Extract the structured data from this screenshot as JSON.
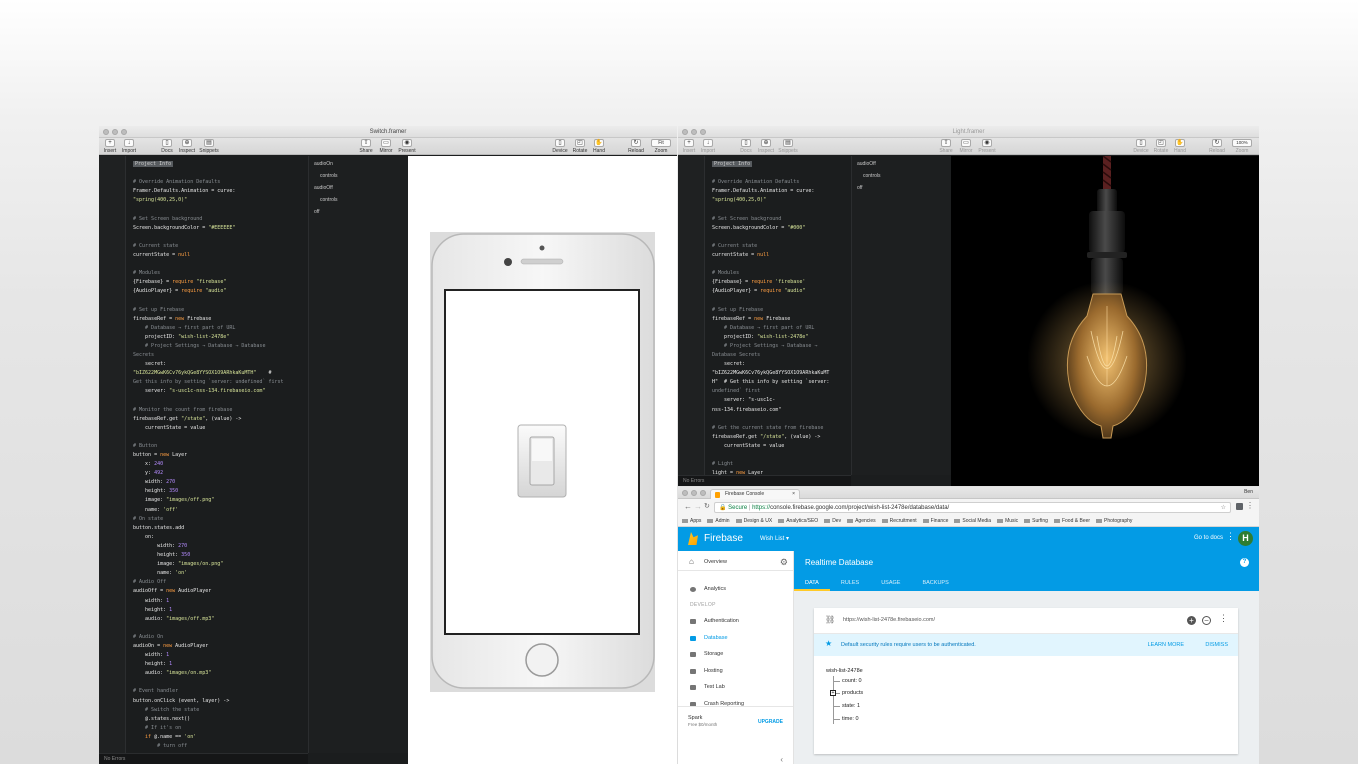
{
  "left_window": {
    "title": "Switch.framer",
    "toolbar": {
      "left": [
        "Insert",
        "Import",
        "Docs",
        "Inspect",
        "Snippets"
      ],
      "center": [
        "Share",
        "Mirror",
        "Present"
      ],
      "right": [
        "Device",
        "Rotate",
        "Hand",
        "Reload",
        "Zoom"
      ],
      "zoom_value": "Fit"
    },
    "code_lines": [
      {
        "t": "Project Info",
        "c": "hl"
      },
      {
        "t": "",
        "c": ""
      },
      {
        "t": "# Override Animation Defaults",
        "c": "cmt"
      },
      {
        "t": "Framer.Defaults.Animation = curve:",
        "c": ""
      },
      {
        "t": "\"spring(400,25,0)\"",
        "c": ""
      },
      {
        "t": "",
        "c": ""
      },
      {
        "t": "# Set Screen background",
        "c": "cmt"
      },
      {
        "t": "Screen.backgroundColor = \"#EEEEEE\"",
        "c": ""
      },
      {
        "t": "",
        "c": ""
      },
      {
        "t": "# Current state",
        "c": "cmt"
      },
      {
        "t": "currentState = null",
        "c": ""
      },
      {
        "t": "",
        "c": ""
      },
      {
        "t": "# Modules",
        "c": "cmt"
      },
      {
        "t": "{Firebase} = require \"firebase\"",
        "c": ""
      },
      {
        "t": "{AudioPlayer} = require \"audio\"",
        "c": ""
      },
      {
        "t": "",
        "c": ""
      },
      {
        "t": "# Set up Firebase",
        "c": "cmt"
      },
      {
        "t": "firebaseRef = new Firebase",
        "c": ""
      },
      {
        "t": "    # Database → first part of URL",
        "c": "cmt"
      },
      {
        "t": "    projectID: \"wish-list-2478e\"",
        "c": ""
      },
      {
        "t": "    # Project Settings → Database → Database",
        "c": "cmt"
      },
      {
        "t": "Secrets",
        "c": "cmt"
      },
      {
        "t": "    secret:",
        "c": ""
      },
      {
        "t": "\"bIZ622MGwK6Cv76ykQGe8YYSOX1O9ARhkaKuMTH\"    #",
        "c": ""
      },
      {
        "t": "Get this info by setting `server: undefined` first",
        "c": "cmt"
      },
      {
        "t": "    server: \"s-usc1c-nss-134.firebaseio.com\"",
        "c": ""
      },
      {
        "t": "",
        "c": ""
      },
      {
        "t": "# Monitor the count from firebase",
        "c": "cmt"
      },
      {
        "t": "firebaseRef.get \"/state\", (value) ->",
        "c": ""
      },
      {
        "t": "    currentState = value",
        "c": ""
      },
      {
        "t": "",
        "c": ""
      },
      {
        "t": "# Button",
        "c": "cmt"
      },
      {
        "t": "button = new Layer",
        "c": ""
      },
      {
        "t": "    x: 240",
        "c": ""
      },
      {
        "t": "    y: 492",
        "c": ""
      },
      {
        "t": "    width: 270",
        "c": ""
      },
      {
        "t": "    height: 350",
        "c": ""
      },
      {
        "t": "    image: \"images/off.png\"",
        "c": ""
      },
      {
        "t": "    name: 'off'",
        "c": ""
      },
      {
        "t": "# On state",
        "c": "cmt"
      },
      {
        "t": "button.states.add",
        "c": ""
      },
      {
        "t": "    on:",
        "c": ""
      },
      {
        "t": "        width: 270",
        "c": ""
      },
      {
        "t": "        height: 350",
        "c": ""
      },
      {
        "t": "        image: \"images/on.png\"",
        "c": ""
      },
      {
        "t": "        name: 'on'",
        "c": ""
      },
      {
        "t": "# Audio Off",
        "c": "cmt"
      },
      {
        "t": "audioOff = new AudioPlayer",
        "c": ""
      },
      {
        "t": "    width: 1",
        "c": ""
      },
      {
        "t": "    height: 1",
        "c": ""
      },
      {
        "t": "    audio: \"images/off.mp3\"",
        "c": ""
      },
      {
        "t": "",
        "c": ""
      },
      {
        "t": "# Audio On",
        "c": "cmt"
      },
      {
        "t": "audioOn = new AudioPlayer",
        "c": ""
      },
      {
        "t": "    width: 1",
        "c": ""
      },
      {
        "t": "    height: 1",
        "c": ""
      },
      {
        "t": "    audio: \"images/on.mp3\"",
        "c": ""
      },
      {
        "t": "",
        "c": ""
      },
      {
        "t": "# Event handler",
        "c": "cmt"
      },
      {
        "t": "button.onClick (event, layer) ->",
        "c": ""
      },
      {
        "t": "    # Switch the state",
        "c": "cmt"
      },
      {
        "t": "    @.states.next()",
        "c": ""
      },
      {
        "t": "    # If it's on",
        "c": "cmt"
      },
      {
        "t": "    if @.name == 'on'",
        "c": ""
      },
      {
        "t": "        # turn off",
        "c": "cmt"
      }
    ],
    "layers": [
      "audioOn",
      "controls",
      "audioOff",
      "controls",
      "off"
    ],
    "layer_indent": [
      false,
      true,
      false,
      true,
      false
    ],
    "status": "No Errors"
  },
  "right_window": {
    "title": "Light.framer",
    "toolbar": {
      "left": [
        "Insert",
        "Import",
        "Docs",
        "Inspect",
        "Snippets"
      ],
      "center": [
        "Share",
        "Mirror",
        "Present"
      ],
      "right": [
        "Device",
        "Rotate",
        "Hand",
        "Reload",
        "Zoom"
      ],
      "zoom_value": "100%"
    },
    "code_lines": [
      {
        "t": "Project Info",
        "c": "hl"
      },
      {
        "t": "",
        "c": ""
      },
      {
        "t": "# Override Animation Defaults",
        "c": "cmt"
      },
      {
        "t": "Framer.Defaults.Animation = curve:",
        "c": ""
      },
      {
        "t": "\"spring(400,25,0)\"",
        "c": ""
      },
      {
        "t": "",
        "c": ""
      },
      {
        "t": "# Set Screen background",
        "c": "cmt"
      },
      {
        "t": "Screen.backgroundColor = \"#000\"",
        "c": ""
      },
      {
        "t": "",
        "c": ""
      },
      {
        "t": "# Current state",
        "c": "cmt"
      },
      {
        "t": "currentState = null",
        "c": ""
      },
      {
        "t": "",
        "c": ""
      },
      {
        "t": "# Modules",
        "c": "cmt"
      },
      {
        "t": "{Firebase} = require 'firebase'",
        "c": ""
      },
      {
        "t": "{AudioPlayer} = require \"audio\"",
        "c": ""
      },
      {
        "t": "",
        "c": ""
      },
      {
        "t": "# Set up Firebase",
        "c": "cmt"
      },
      {
        "t": "firebaseRef = new Firebase",
        "c": ""
      },
      {
        "t": "    # Database → first part of URL",
        "c": "cmt"
      },
      {
        "t": "    projectID: \"wish-list-2478e\"",
        "c": ""
      },
      {
        "t": "    # Project Settings → Database →",
        "c": "cmt"
      },
      {
        "t": "Database Secrets",
        "c": "cmt"
      },
      {
        "t": "    secret:",
        "c": ""
      },
      {
        "t": "\"bIZ622MGwK6Cv76ykQGe8YYSOX1O9ARhkaKuMT",
        "c": ""
      },
      {
        "t": "H\"  # Get this info by setting `server:",
        "c": ""
      },
      {
        "t": "undefined` first",
        "c": "cmt"
      },
      {
        "t": "    server: \"s-usc1c-",
        "c": ""
      },
      {
        "t": "nss-134.firebaseio.com\"",
        "c": ""
      },
      {
        "t": "",
        "c": ""
      },
      {
        "t": "# Get the current state from firebase",
        "c": "cmt"
      },
      {
        "t": "firebaseRef.get \"/state\", (value) ->",
        "c": ""
      },
      {
        "t": "    currentState = value",
        "c": ""
      },
      {
        "t": "",
        "c": ""
      },
      {
        "t": "# Light",
        "c": "cmt"
      },
      {
        "t": "light = new Layer",
        "c": ""
      }
    ],
    "layers": [
      "audioOff",
      "controls",
      "off"
    ],
    "layer_indent": [
      false,
      true,
      false
    ],
    "status": "No Errors"
  },
  "browser": {
    "tab_title": "Firebase Console",
    "profile": "Ben",
    "secure_label": "Secure",
    "url_scheme": "https://",
    "url_rest": "console.firebase.google.com/project/wish-list-2478e/database/data/",
    "bookmarks": [
      "Apps",
      "Admin",
      "Design & UX",
      "Analytics/SEO",
      "Dev",
      "Agencies",
      "Recruitment",
      "Finance",
      "Social Media",
      "Music",
      "Surfing",
      "Food & Beer",
      "Photography"
    ],
    "firebase": {
      "brand": "Firebase",
      "project": "Wish List",
      "go_to_docs": "Go to docs",
      "avatar_letter": "H",
      "page_title": "Realtime Database",
      "tabs": [
        "DATA",
        "RULES",
        "USAGE",
        "BACKUPS"
      ],
      "overview": "Overview",
      "develop_label": "DEVELOP",
      "analytics": "Analytics",
      "nav": [
        "Authentication",
        "Database",
        "Storage",
        "Hosting",
        "Test Lab",
        "Crash Reporting"
      ],
      "plan_name": "Spark",
      "plan_price": "Free $0/month",
      "upgrade": "UPGRADE",
      "db_url": "https://wish-list-2478e.firebaseio.com/",
      "warning": "Default security rules require users to be authenticated.",
      "learn_more": "LEARN MORE",
      "dismiss": "DISMISS",
      "tree_root": "wish-list-2478e",
      "tree": {
        "count": "count: 0",
        "products": "products",
        "state": "state: 1",
        "time": "time: 0"
      }
    }
  },
  "colors": {
    "firebase_blue": "#039be5",
    "firebase_yellow": "#ffca28",
    "code_bg": "#1b1d1e",
    "string_green": "#d8e59a",
    "keyword_orange": "#ff9f43",
    "number_purple": "#b58cff"
  }
}
